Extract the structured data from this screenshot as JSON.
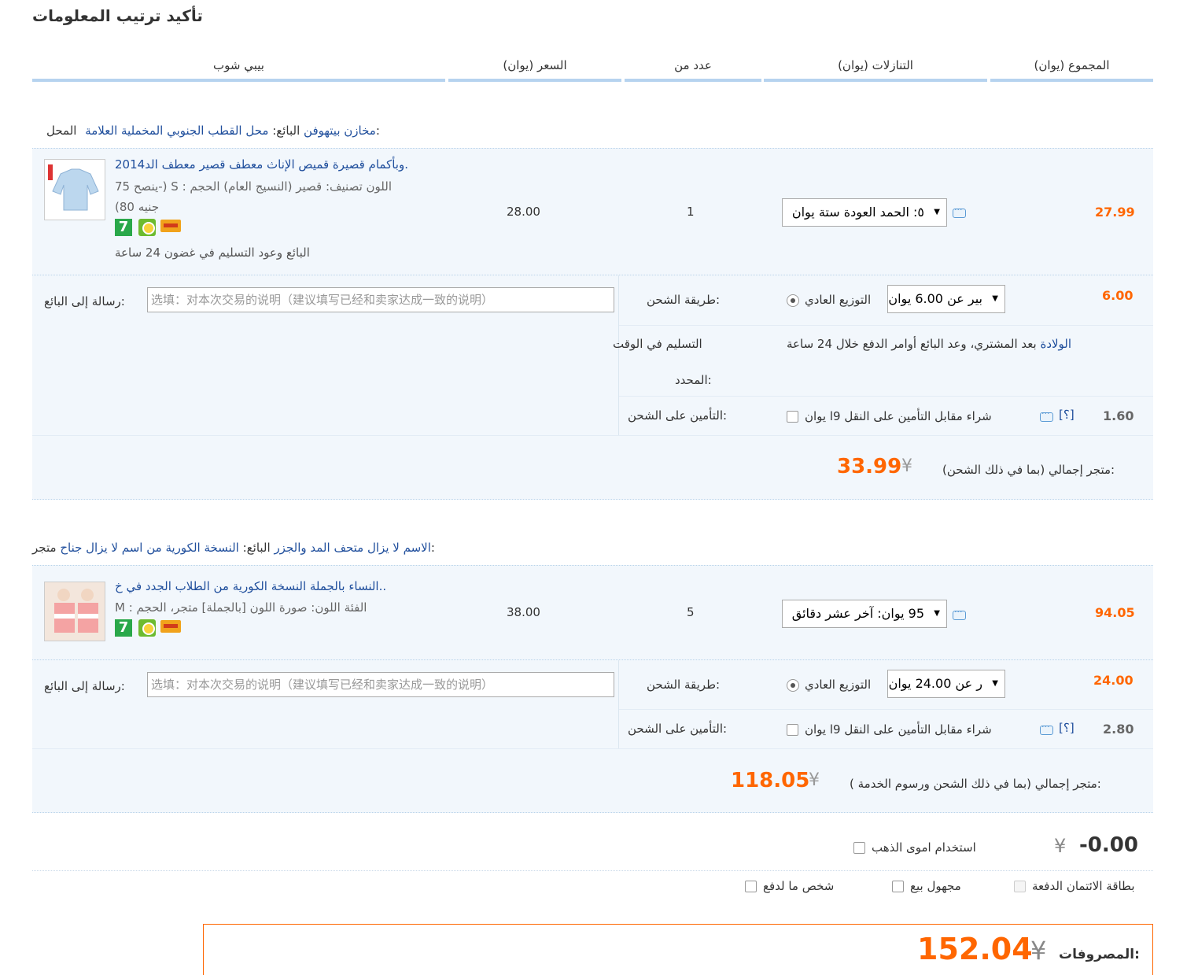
{
  "page_title": "تأكيد ترتيب المعلومات",
  "headers": {
    "store": "بيبي شوب",
    "price": "(السعر (يوان",
    "qty": "عدد من",
    "discount": "(التنازلات (يوان",
    "total": "(المجموع (يوان"
  },
  "currency": "¥",
  "orders": [
    {
      "seller_line": {
        "shop_label": "المحل:",
        "shop_name": "محل القطب الجنوبي المخملية العلامة",
        "seller_label": "البائع:",
        "seller_name": "مخازن بيتهوفن"
      },
      "item": {
        "title": "وبأكمام قصيرة قميص الإناث معطف قصير معطف الد2014.",
        "attrs_line1": "ينصح 75-) S : اللون تصنيف: قصير (النسيج العام) الحجم",
        "attrs_line2": "(80 جنيه",
        "delivery_note": "البائع وعود التسليم في غضون 24 ساعة",
        "price": "28.00",
        "qty": "1",
        "discount_select": "٥: الحمد العودة ستة يوان",
        "total": "27.99"
      },
      "shipping": {
        "message_label": "رسالة إلى البائع:",
        "message_placeholder": "选填：对本次交易的说明（建议填写已经和卖家达成一致的说明）",
        "method_label": "طريقة الشحن:",
        "method_name": "التوزيع العادي",
        "method_select": "بير عن 6.00 يوان",
        "cost": "6.00",
        "ontime_label_1": "التسليم في الوقت",
        "ontime_label_2": "المحدد:",
        "ontime_text": "بعد المشتري، وعد البائع أوامر الدفع خلال 24 ساعة",
        "ontime_link": "الولادة",
        "insurance_label": "التأمين على الشحن:",
        "insurance_text": "شراء مقابل التأمين على النقل 9ا يوان",
        "insurance_help": "[؟]",
        "insurance_cost": "1.60"
      },
      "store_total_label": "متجر إجمالي (بما في ذلك الشحن):",
      "store_total": "33.99"
    },
    {
      "seller_line": {
        "shop_label": "متجر:",
        "shop_name": "النسخة الكورية من اسم لا يزال جناح",
        "seller_label": "البائع:",
        "seller_name": "الاسم لا يزال متحف المد والجزر"
      },
      "item": {
        "title": "النساء بالجملة النسخة الكورية من الطلاب الجدد في خ..",
        "attrs_line1": "M : الفئة اللون: صورة اللون [بالجملة] متجر، الحجم",
        "price": "38.00",
        "qty": "5",
        "discount_select": "95 يوان: آخر عشر دقائق",
        "total": "94.05"
      },
      "shipping": {
        "message_label": "رسالة إلى البائع:",
        "message_placeholder": "选填：对本次交易的说明（建议填写已经和卖家达成一致的说明）",
        "method_label": "طريقة الشحن:",
        "method_name": "التوزيع العادي",
        "method_select": "ر عن 24.00 يوان",
        "cost": "24.00",
        "insurance_label": "التأمين على الشحن:",
        "insurance_text": "شراء مقابل التأمين على النقل 9ا يوان",
        "insurance_help": "[؟]",
        "insurance_cost": "2.80"
      },
      "store_total_label": "متجر إجمالي (بما في ذلك الشحن ورسوم الخدمة ):",
      "store_total": "118.05"
    }
  ],
  "gold": {
    "label": "استخدام اموى الذهب",
    "amount": "-0.00"
  },
  "payment_options": {
    "credit_card": "بطاقة الائتمان الدفعة",
    "anonymous": "مجهول بيع",
    "someone_pay": "شخص ما لدفع"
  },
  "grand_total": {
    "label": "المصروفات:",
    "amount": "152.04"
  },
  "colors": {
    "accent_orange": "#ff6600",
    "link_blue": "#1f4e9c",
    "band_bg": "#f2f7fc",
    "header_line": "#b6d3ef"
  }
}
